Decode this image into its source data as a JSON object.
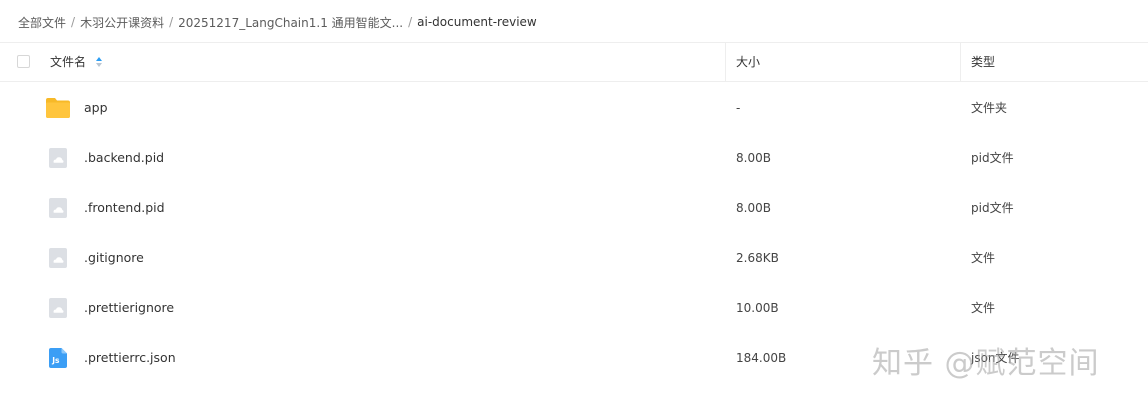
{
  "breadcrumb": {
    "items": [
      "全部文件",
      "木羽公开课资料",
      "20251217_LangChain1.1 通用智能文...",
      "ai-document-review"
    ],
    "separator": "/"
  },
  "table": {
    "columns": {
      "name": "文件名",
      "size": "大小",
      "type": "类型"
    },
    "sort": {
      "column": "name",
      "direction": "ascending"
    },
    "rows": [
      {
        "name": "app",
        "size": "-",
        "type": "文件夹",
        "icon": "folder-icon"
      },
      {
        "name": ".backend.pid",
        "size": "8.00B",
        "type": "pid文件",
        "icon": "file-icon"
      },
      {
        "name": ".frontend.pid",
        "size": "8.00B",
        "type": "pid文件",
        "icon": "file-icon"
      },
      {
        "name": ".gitignore",
        "size": "2.68KB",
        "type": "文件",
        "icon": "file-icon"
      },
      {
        "name": ".prettierignore",
        "size": "10.00B",
        "type": "文件",
        "icon": "file-icon"
      },
      {
        "name": ".prettierrc.json",
        "size": "184.00B",
        "type": "json文件",
        "icon": "js-file-icon"
      }
    ]
  },
  "watermark": "知乎 @赋范空间",
  "colors": {
    "folder": "#ffc53d",
    "file": "#dcdfe4",
    "js_file": "#3b9ef5",
    "sort_active": "#2a9df4"
  }
}
